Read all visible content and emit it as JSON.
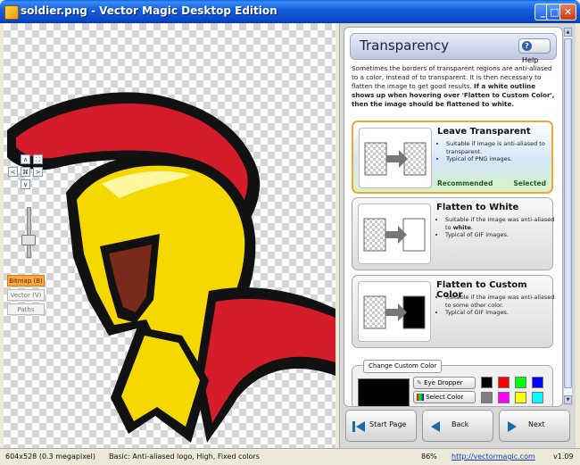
{
  "window": {
    "title": "soldier.png - Vector Magic Desktop Edition",
    "buttons": {
      "minimize": "_",
      "maximize": "□",
      "close": "✕"
    }
  },
  "canvas_tools": {
    "nav": {
      "up": "∧",
      "down": "∨",
      "left": "<",
      "right": ">",
      "center": "⌘",
      "fit": "⛶"
    },
    "modes": [
      {
        "label": "Bitmap (B)",
        "active": true
      },
      {
        "label": "Vector (V)",
        "active": false
      },
      {
        "label": "Paths",
        "active": false
      }
    ],
    "zoom_level": 0.3
  },
  "panel": {
    "title": "Transparency",
    "help_label": "Help",
    "description": "Sometimes the borders of transparent regions are anti-aliased to a color, instead of to transparent. It is then necessary to flatten the image to get good results.",
    "description_bold": "If a white outline shows up when hovering over 'Flatten to Custom Color', then the image should be flattened to white.",
    "options": [
      {
        "title": "Leave Transparent",
        "bullet1": "Suitable if image is anti-aliased to transparent.",
        "bullet2": "Typical of PNG images.",
        "recommended": "Recommended",
        "selected": "Selected"
      },
      {
        "title": "Flatten to White",
        "bullet1_pre": "Suitable if the image was anti-aliased to ",
        "bullet1_bold": "white",
        "bullet1_post": ".",
        "bullet2": "Typical of GIF images."
      },
      {
        "title": "Flatten to Custom Color",
        "bullet1": "Suitable if the image was anti-aliased to some other color.",
        "bullet2": "Typical of GIF images."
      }
    ],
    "custom_color": {
      "tab_label": "Change Custom Color",
      "eye_dropper": "Eye Dropper",
      "select_color": "Select Color",
      "current_color": "#000000",
      "swatches": [
        "#000000",
        "#ff0000",
        "#00ff00",
        "#0000ff",
        "#808080",
        "#ff00ff",
        "#ffff00",
        "#00ffff"
      ]
    },
    "wizard": {
      "start": "Start Page",
      "back": "Back",
      "next": "Next"
    }
  },
  "status": {
    "image_info": "604x528 (0.3 megapixel)",
    "settings": "Basic: Anti-aliased logo, High, Fixed colors",
    "zoom": "86%",
    "url": "http://vectormagic.com",
    "version": "v1.09"
  },
  "colors": {
    "title_bar": "#1560de",
    "selected_option_border": "#f0a830",
    "active_mode": "#f9a740",
    "helmet_yellow": "#f5d800",
    "crest_red": "#d41c2a"
  }
}
